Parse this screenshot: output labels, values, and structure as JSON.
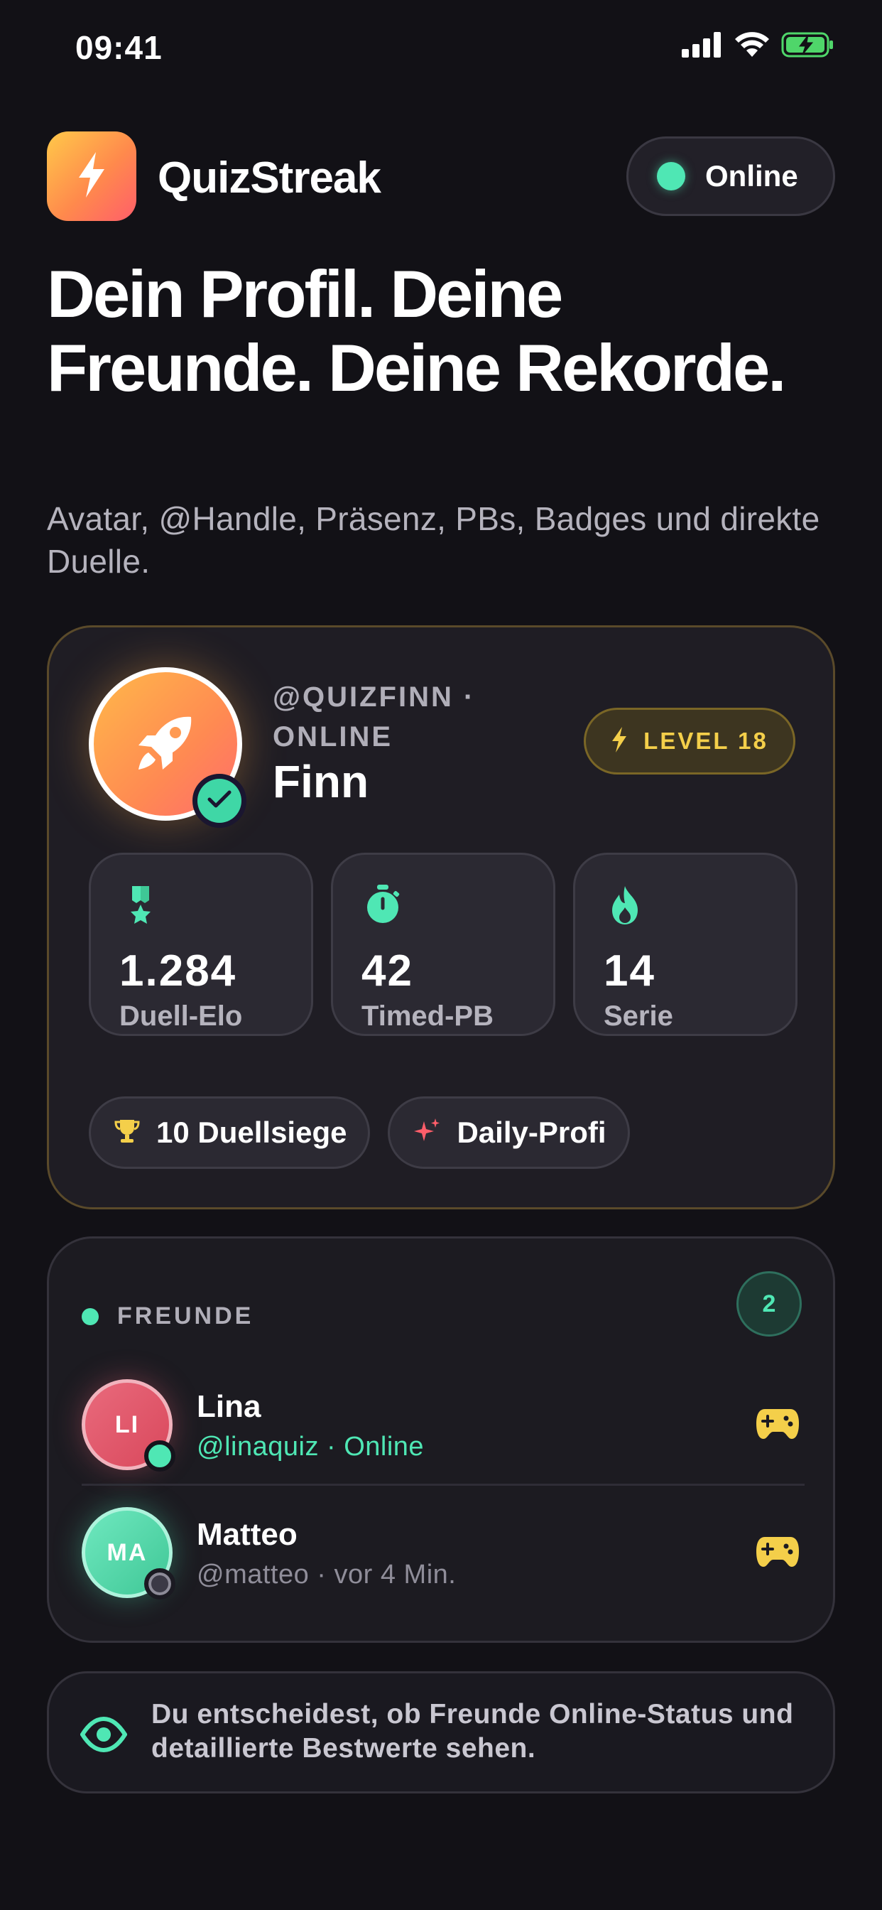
{
  "status_bar": {
    "time": "09:41",
    "icons": [
      "signal-icon",
      "wifi-icon",
      "battery-charging-icon"
    ]
  },
  "header": {
    "app_name": "QuizStreak",
    "logo_icon": "bolt-icon",
    "presence_label": "Online",
    "presence_color": "#4fe7b4"
  },
  "hero": {
    "title": "Dein Profil. Deine Freunde. Deine Rekorde.",
    "subtitle": "Avatar, @Handle, Präsenz, PBs, Badges und direkte Duelle."
  },
  "profile": {
    "handle_line": "@QUIZFINN · ONLINE",
    "name": "Finn",
    "avatar_icon": "rocket-icon",
    "verified_icon": "check-icon",
    "level_label": "LEVEL 18",
    "level_icon": "bolt-icon",
    "stats": [
      {
        "icon": "medal-icon",
        "value": "1.284",
        "label": "Duell-Elo"
      },
      {
        "icon": "stopwatch-icon",
        "value": "42",
        "label": "Timed-PB"
      },
      {
        "icon": "flame-icon",
        "value": "14",
        "label": "Serie"
      }
    ],
    "badges": [
      {
        "icon": "trophy-icon",
        "label": "10 Duellsiege"
      },
      {
        "icon": "sparkle-icon",
        "label": "Daily-Profi"
      }
    ]
  },
  "friends": {
    "title": "FREUNDE",
    "count": "2",
    "items": [
      {
        "initials": "LI",
        "name": "Lina",
        "meta": "@linaquiz · Online",
        "status": "online",
        "action_icon": "gamepad-icon"
      },
      {
        "initials": "MA",
        "name": "Matteo",
        "meta": "@matteo · vor 4 Min.",
        "status": "away",
        "action_icon": "gamepad-icon"
      }
    ]
  },
  "privacy": {
    "icon": "eye-icon",
    "text": "Du entscheidest, ob Freunde Online-Status und detaillierte Bestwerte sehen."
  },
  "colors": {
    "background": "#121116",
    "accent_green": "#4fe7b4",
    "accent_gold": "#f4cf4a",
    "accent_coral": "#ff5e6a"
  }
}
